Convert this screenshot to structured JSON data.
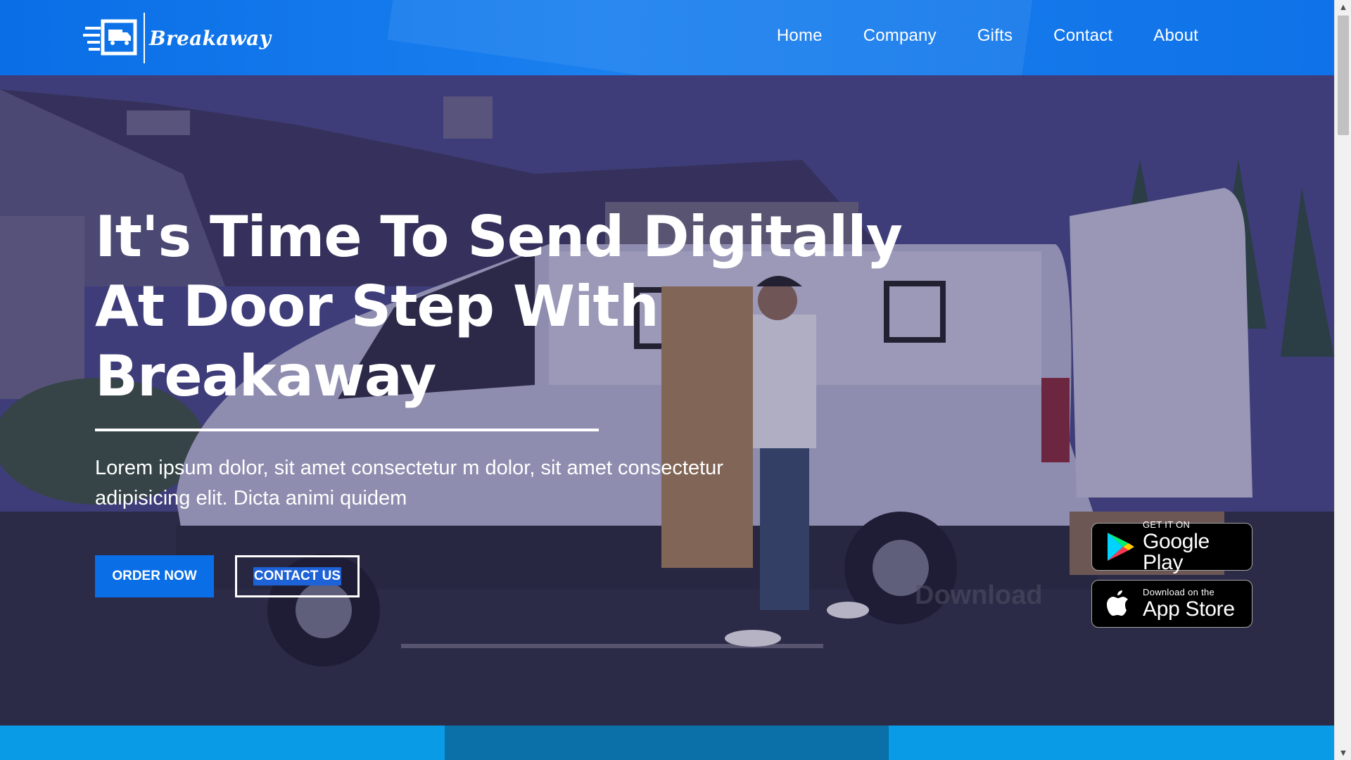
{
  "brand": {
    "name": "Breakaway",
    "icon": "delivery-truck-logo-icon"
  },
  "nav": {
    "items": [
      {
        "label": "Home"
      },
      {
        "label": "Company"
      },
      {
        "label": "Gifts"
      },
      {
        "label": "Contact"
      },
      {
        "label": "About"
      }
    ]
  },
  "hero": {
    "headline_lines": [
      "It's Time To Send Digitally",
      "At Door Step With",
      "Breakaway"
    ],
    "lead_lines": [
      "Lorem ipsum dolor, sit amet consectetur m dolor, sit amet consectetur",
      "adipisicing elit. Dicta animi quidem"
    ],
    "order_label": "ORDER NOW",
    "contact_label": "CONTACT US",
    "download_text": "Download",
    "background_image": "delivery-man-carrying-boxes-near-white-van"
  },
  "badges": {
    "google_play": {
      "small": "GET IT ON",
      "big": "Google Play",
      "icon": "google-play-icon"
    },
    "app_store": {
      "small": "Download on the",
      "big": "App Store",
      "icon": "apple-icon"
    }
  },
  "colors": {
    "primary": "#0a6ee6",
    "strip": "#0a9be6",
    "strip_mid": "#0b6fa8"
  }
}
